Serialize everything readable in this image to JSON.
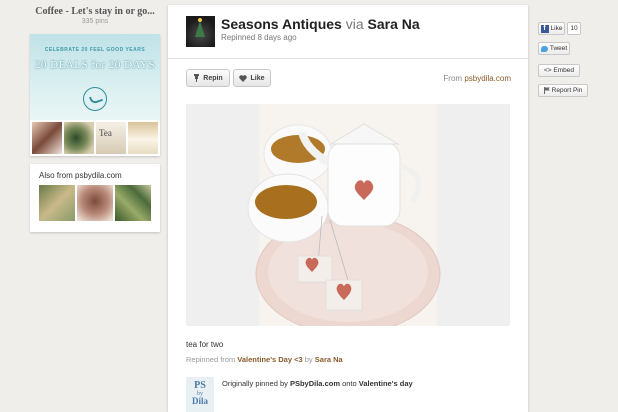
{
  "board": {
    "title": "Coffee - Let's stay in or go...",
    "pin_count": "335 pins"
  },
  "ad": {
    "line1": "CELEBRATE 20 FEEL GOOD YEARS",
    "line2": "20 DEALS for 20 DAYS",
    "thumb_text": "Tea"
  },
  "also_from": {
    "label": "Also from",
    "source": "psbydila.com"
  },
  "pin": {
    "board_name": "Seasons Antiques",
    "via_label": "via",
    "pinner": "Sara Na",
    "repinned_time": "Repinned 8 days ago",
    "repin_label": "Repin",
    "like_label": "Like",
    "from_label": "From",
    "from_source": "psbydila.com",
    "caption": "tea for two",
    "repinned_from_label": "Repinned from",
    "repinned_from_board": "Valentine's Day <3",
    "by_label": "by",
    "repinned_from_user": "Sara Na",
    "originally_label": "Originally pinned by",
    "original_pinner": "PSbyDila.com",
    "onto_label": "onto",
    "original_board": "Valentine's day",
    "logo_line1": "PS",
    "logo_line2": "by",
    "logo_line3": "Dila"
  },
  "social": {
    "fb_like": "Like",
    "fb_count": "10",
    "tweet": "Tweet",
    "embed": "<> Embed",
    "report": "Report Pin"
  },
  "icons": {
    "repin": "pushpin-icon",
    "like": "heart-icon",
    "facebook": "facebook-icon",
    "twitter": "twitter-bird-icon",
    "report": "flag-icon"
  },
  "colors": {
    "link": "#8a5a2a",
    "background": "#f0eeeb",
    "heart": "#c8695a",
    "facebook": "#3b5998",
    "twitter": "#4aa3df"
  }
}
